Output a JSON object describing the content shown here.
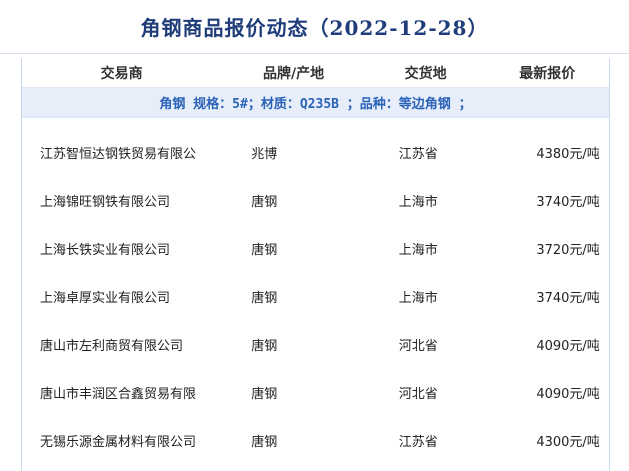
{
  "title": "角钢商品报价动态（2022-12-28）",
  "table": {
    "headers": [
      "交易商",
      "品牌/产地",
      "交货地",
      "最新报价"
    ],
    "spec": "角钢  规格：5#；材质：Q235B ；品种：等边角钢 ；",
    "rows": [
      {
        "trader": "江苏智恒达钢铁贸易有限公",
        "brand": "兆博",
        "delivery": "江苏省",
        "price": "4380元/吨"
      },
      {
        "trader": "上海锦旺钢铁有限公司",
        "brand": "唐钢",
        "delivery": "上海市",
        "price": "3740元/吨"
      },
      {
        "trader": "上海长铁实业有限公司",
        "brand": "唐钢",
        "delivery": "上海市",
        "price": "3720元/吨"
      },
      {
        "trader": "上海卓厚实业有限公司",
        "brand": "唐钢",
        "delivery": "上海市",
        "price": "3740元/吨"
      },
      {
        "trader": "唐山市左利商贸有限公司",
        "brand": "唐钢",
        "delivery": "河北省",
        "price": "4090元/吨"
      },
      {
        "trader": "唐山市丰润区合鑫贸易有限",
        "brand": "唐钢",
        "delivery": "河北省",
        "price": "4090元/吨"
      },
      {
        "trader": "无锡乐源金属材料有限公司",
        "brand": "唐钢",
        "delivery": "江苏省",
        "price": "4300元/吨"
      }
    ]
  }
}
